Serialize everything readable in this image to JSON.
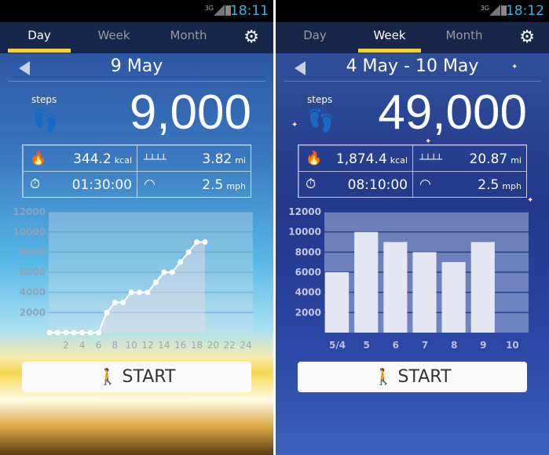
{
  "phones": [
    {
      "status": {
        "network": "3G",
        "time": "18:11"
      },
      "tabs": [
        "Day",
        "Week",
        "Month"
      ],
      "active_tab": 0,
      "settings_icon": "gear-icon",
      "date": "9 May",
      "steps_label": "steps",
      "steps": "9,000",
      "stats": {
        "calories": "344.2",
        "calories_unit": "kcal",
        "distance": "3.82",
        "distance_unit": "mi",
        "duration": "01:30:00",
        "speed": "2.5",
        "speed_unit": "mph"
      },
      "start_label": "START"
    },
    {
      "status": {
        "network": "3G",
        "time": "18:12"
      },
      "tabs": [
        "Day",
        "Week",
        "Month"
      ],
      "active_tab": 1,
      "settings_icon": "gear-icon",
      "date": "4 May - 10 May",
      "steps_label": "steps",
      "steps": "49,000",
      "stats": {
        "calories": "1,874.4",
        "calories_unit": "kcal",
        "distance": "20.87",
        "distance_unit": "mi",
        "duration": "08:10:00",
        "speed": "2.5",
        "speed_unit": "mph"
      },
      "start_label": "START"
    }
  ],
  "colors": {
    "tab_indicator": "#f5d23a",
    "clock": "#33b5e5"
  },
  "chart_data": [
    {
      "type": "line",
      "x": [
        0,
        1,
        2,
        3,
        4,
        5,
        6,
        7,
        8,
        9,
        10,
        11,
        12,
        13,
        14,
        15,
        16,
        17,
        18,
        19
      ],
      "values": [
        0,
        0,
        0,
        0,
        0,
        0,
        0,
        2000,
        3000,
        3000,
        4000,
        4000,
        4000,
        5000,
        6000,
        6000,
        7000,
        8000,
        9000,
        9000
      ],
      "xlim": [
        0,
        24
      ],
      "ylim": [
        0,
        12000
      ],
      "yticks": [
        "2000",
        "4000",
        "6000",
        "8000",
        "10000",
        "12000"
      ],
      "xticks": [
        "2",
        "4",
        "6",
        "8",
        "10",
        "12",
        "14",
        "16",
        "18",
        "20",
        "22",
        "24"
      ],
      "grid": true
    },
    {
      "type": "bar",
      "categories": [
        "5/4",
        "5",
        "6",
        "7",
        "8",
        "9",
        "10"
      ],
      "values": [
        6000,
        10000,
        9000,
        8000,
        7000,
        9000,
        null
      ],
      "ylim": [
        0,
        12000
      ],
      "yticks": [
        "2000",
        "4000",
        "6000",
        "8000",
        "10000",
        "12000"
      ],
      "grid": true
    }
  ]
}
